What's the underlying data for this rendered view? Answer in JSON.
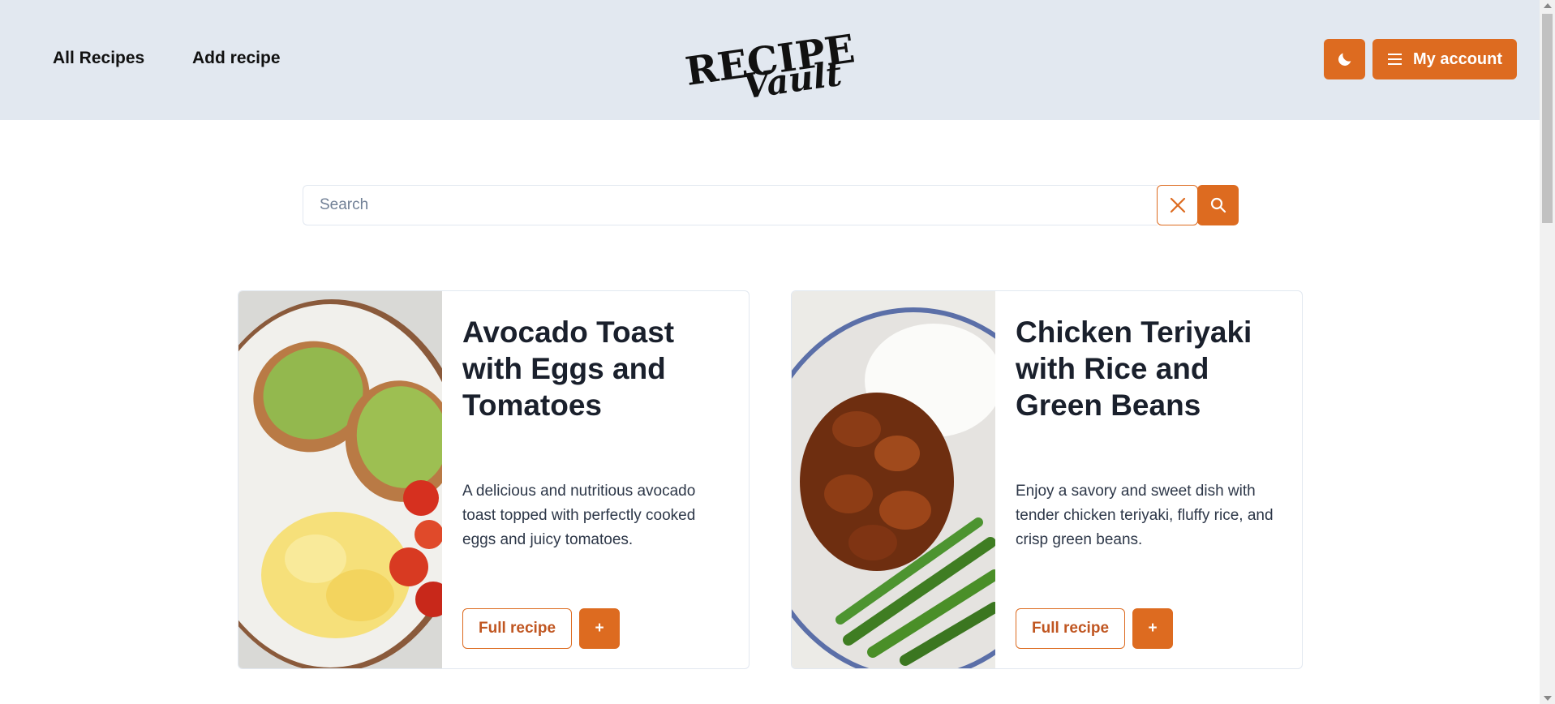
{
  "header": {
    "nav": {
      "all_recipes": "All Recipes",
      "add_recipe": "Add recipe"
    },
    "logo": {
      "word1": "RECIPE",
      "word2": "Vault"
    },
    "theme_toggle_icon": "moon-icon",
    "account_button": {
      "icon": "menu-icon",
      "label": "My account"
    }
  },
  "search": {
    "placeholder": "Search",
    "value": "",
    "clear_icon": "close-icon",
    "submit_icon": "search-icon"
  },
  "recipes": [
    {
      "title": "Avocado Toast with Eggs and Tomatoes",
      "description": "A delicious and nutritious avocado toast topped with perfectly cooked eggs and juicy tomatoes.",
      "full_recipe_label": "Full recipe",
      "add_label": "+"
    },
    {
      "title": "Chicken Teriyaki with Rice and Green Beans",
      "description": "Enjoy a savory and sweet dish with tender chicken teriyaki, fluffy rice, and crisp green beans.",
      "full_recipe_label": "Full recipe",
      "add_label": "+"
    }
  ],
  "colors": {
    "accent": "#dd6b20",
    "header_bg": "#e2e8f0"
  }
}
